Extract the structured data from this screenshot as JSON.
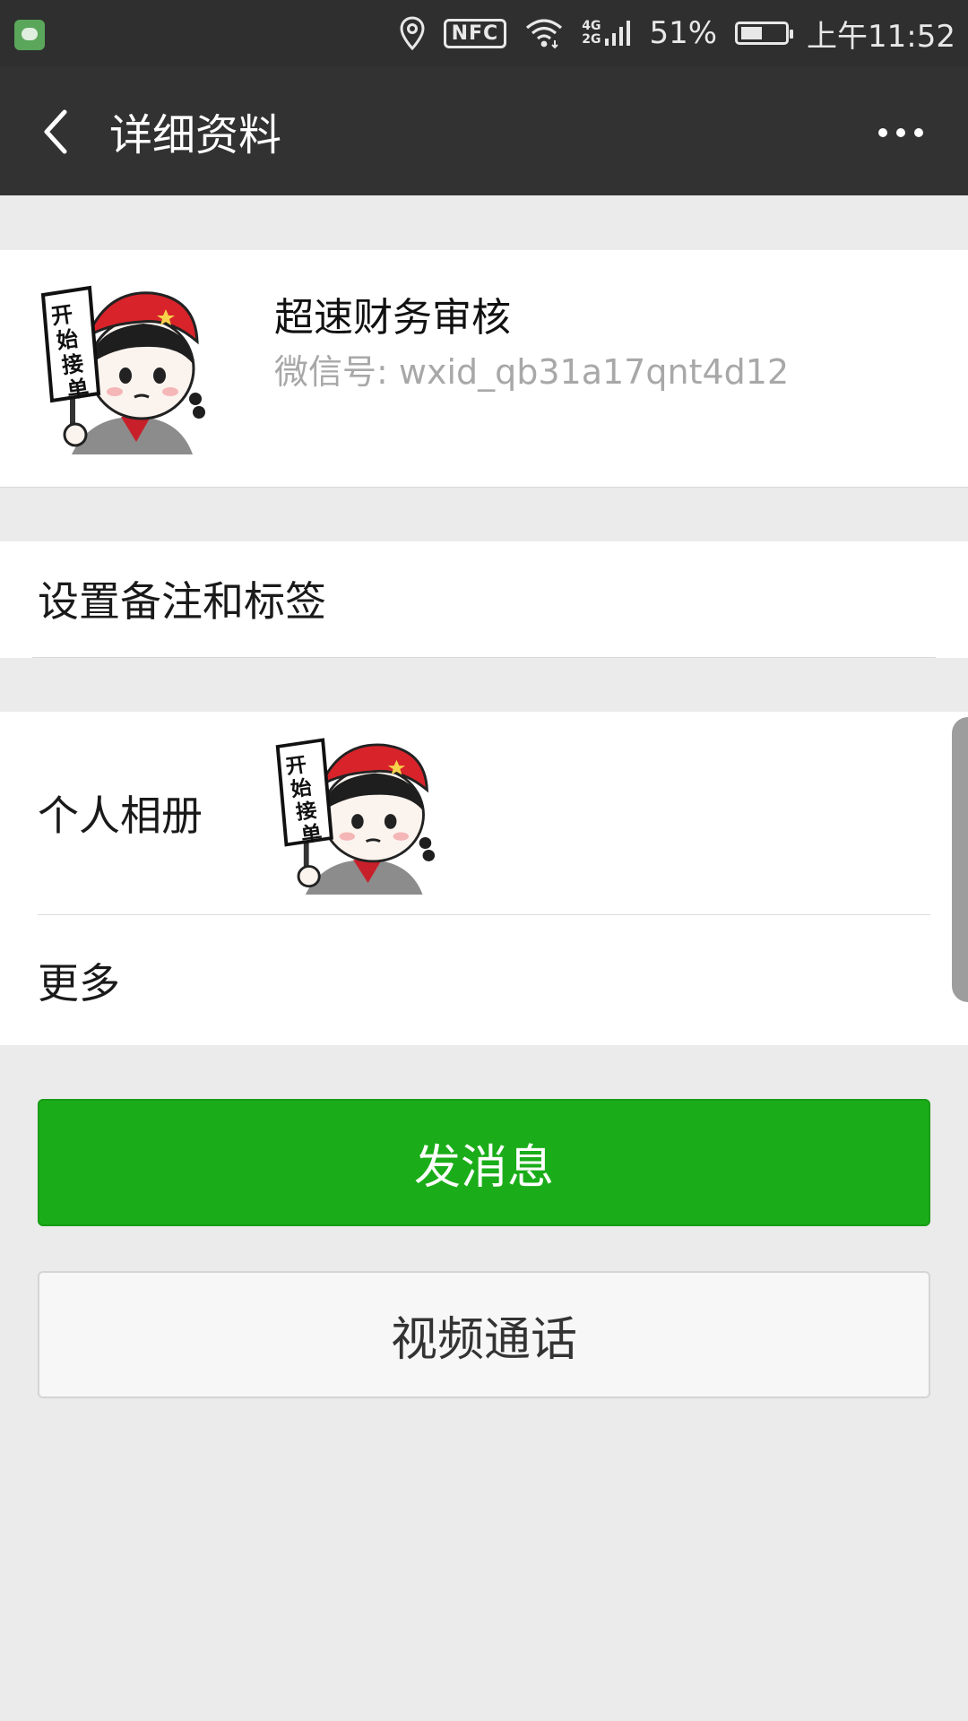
{
  "status_bar": {
    "icons": [
      "app-notification-icon",
      "location-icon",
      "nfc-icon",
      "wifi-icon",
      "cellular-signal-icon",
      "battery-icon"
    ],
    "nfc_label": "NFC",
    "network_4g": "4G",
    "network_2g": "2G",
    "battery_percent": "51%",
    "battery_level": 0.51,
    "time": "上午11:52"
  },
  "nav": {
    "title": "详细资料",
    "back_icon": "chevron-left-icon",
    "more_icon": "more-horizontal-icon"
  },
  "profile": {
    "name": "超速财务审核",
    "wechat_id": "微信号: wxid_qb31a17qnt4d12",
    "avatar_sign_text": "开始接单"
  },
  "menu": {
    "remark_label": "设置备注和标签",
    "album_label": "个人相册",
    "album_sign_text": "开始接单",
    "more_label": "更多"
  },
  "buttons": {
    "send_message": "发消息",
    "video_call": "视频通话"
  },
  "colors": {
    "primary_green": "#1aad19",
    "nav_bg": "#323232",
    "page_bg": "#ebebeb"
  }
}
